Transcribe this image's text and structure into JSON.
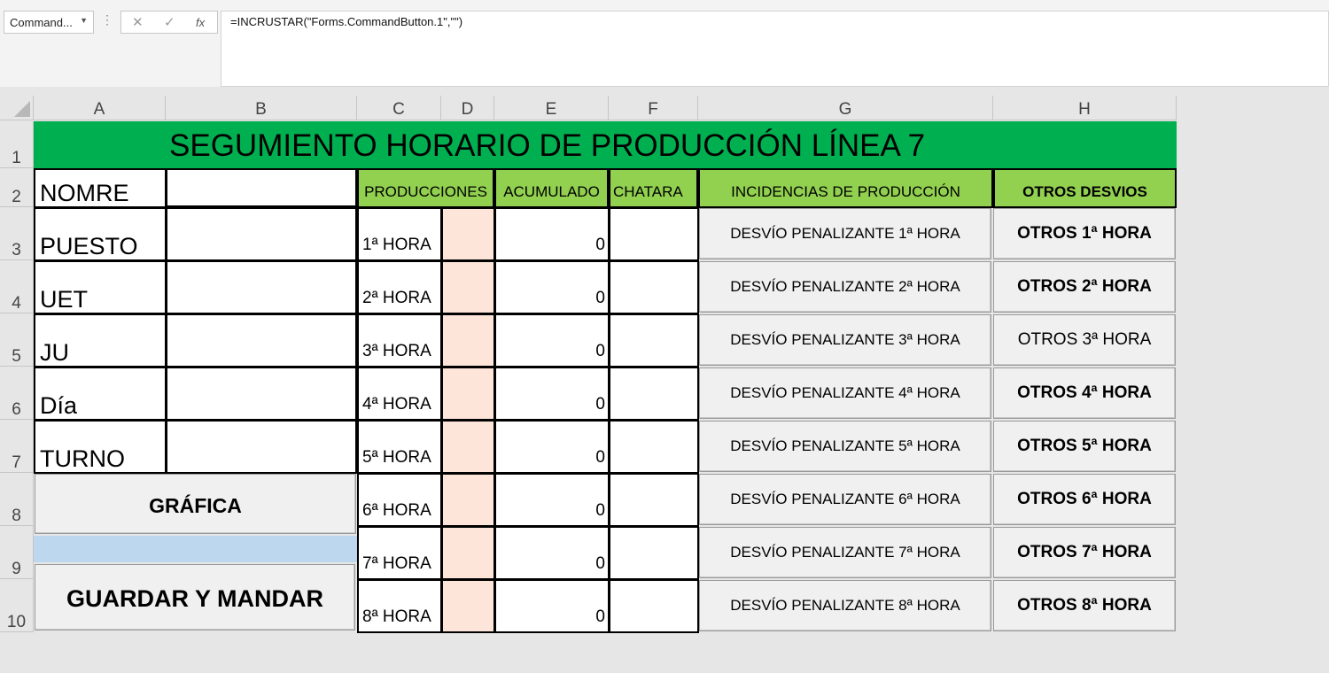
{
  "formula_bar": {
    "name_box": "Command...",
    "cancel_icon": "✕",
    "enter_icon": "✓",
    "fx_icon": "fx",
    "formula": "=INCRUSTAR(\"Forms.CommandButton.1\",\"\")"
  },
  "columns": [
    "A",
    "B",
    "C",
    "D",
    "E",
    "F",
    "G",
    "H"
  ],
  "rows": [
    "1",
    "2",
    "3",
    "4",
    "5",
    "6",
    "7",
    "8",
    "9",
    "10"
  ],
  "title": "SEGUMIENTO HORARIO DE PRODUCCIÓN LÍNEA 7",
  "headers": {
    "producciones": "PRODUCCIONES",
    "acumulado": "ACUMULADO",
    "chatara": "CHATARA",
    "incidencias": "INCIDENCIAS DE PRODUCCIÓN",
    "otros": "OTROS DESVIOS"
  },
  "labels": [
    "NOMRE",
    "PUESTO",
    "UET",
    "JU",
    "Día",
    "TURNO"
  ],
  "horas": [
    "1ª HORA",
    "2ª HORA",
    "3ª HORA",
    "4ª HORA",
    "5ª HORA",
    "6ª HORA",
    "7ª HORA",
    "8ª HORA"
  ],
  "acumulado": [
    "0",
    "0",
    "0",
    "0",
    "0",
    "0",
    "0",
    "0"
  ],
  "desvio_buttons": [
    "DESVÍO PENALIZANTE 1ª HORA",
    "DESVÍO PENALIZANTE 2ª HORA",
    "DESVÍO PENALIZANTE 3ª HORA",
    "DESVÍO PENALIZANTE 4ª HORA",
    "DESVÍO PENALIZANTE 5ª HORA",
    "DESVÍO PENALIZANTE 6ª HORA",
    "DESVÍO PENALIZANTE 7ª HORA",
    "DESVÍO PENALIZANTE 8ª HORA"
  ],
  "otros_buttons": [
    "OTROS 1ª HORA",
    "OTROS 2ª HORA",
    "OTROS 3ª HORA",
    "OTROS 4ª HORA",
    "OTROS 5ª HORA",
    "OTROS 6ª HORA",
    "OTROS 7ª HORA",
    "OTROS 8ª HORA"
  ],
  "grafica_button": "GRÁFICA",
  "guardar_button": "GUARDAR Y MANDAR",
  "colors": {
    "title_green": "#00b050",
    "header_green": "#92d050",
    "pink": "#fde5da",
    "blue": "#bdd7ee"
  }
}
